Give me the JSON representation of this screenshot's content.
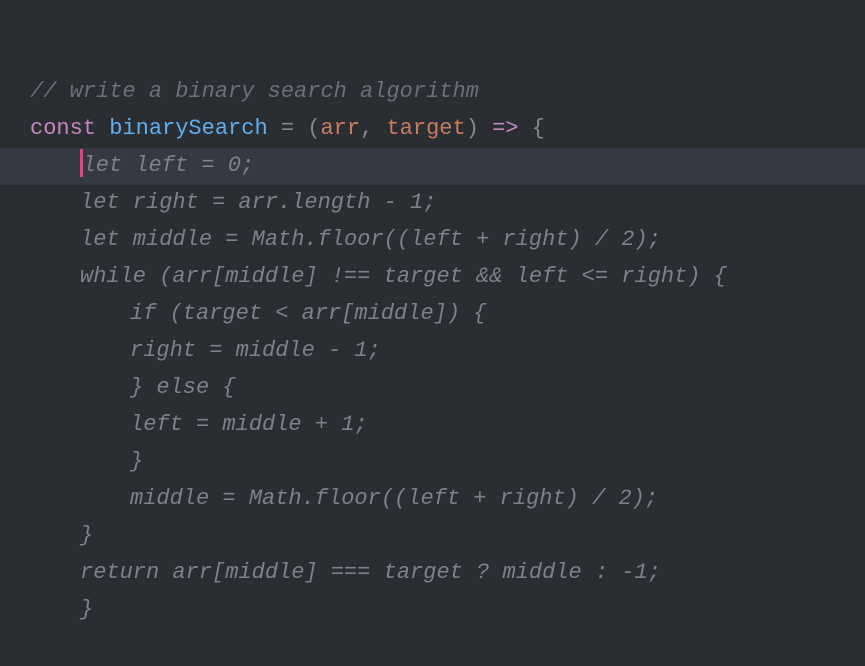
{
  "code": {
    "line1_comment": "// write a binary search algorithm",
    "line2_const": "const ",
    "line2_func": "binarySearch",
    "line2_eq": " = ",
    "line2_open": "(",
    "line2_param1": "arr",
    "line2_comma": ", ",
    "line2_param2": "target",
    "line2_close": ")",
    "line2_arrow": " => ",
    "line2_brace": "{",
    "line3": "let left = 0;",
    "line4": "let right = arr.length - 1;",
    "line5": "let middle = Math.floor((left + right) / 2);",
    "line6": "while (arr[middle] !== target && left <= right) {",
    "line7": "if (target < arr[middle]) {",
    "line8": "right = middle - 1;",
    "line9": "} else {",
    "line10": "left = middle + 1;",
    "line11": "}",
    "line12": "middle = Math.floor((left + right) / 2);",
    "line13": "}",
    "line14": "return arr[middle] === target ? middle : -1;",
    "line15": "}"
  }
}
